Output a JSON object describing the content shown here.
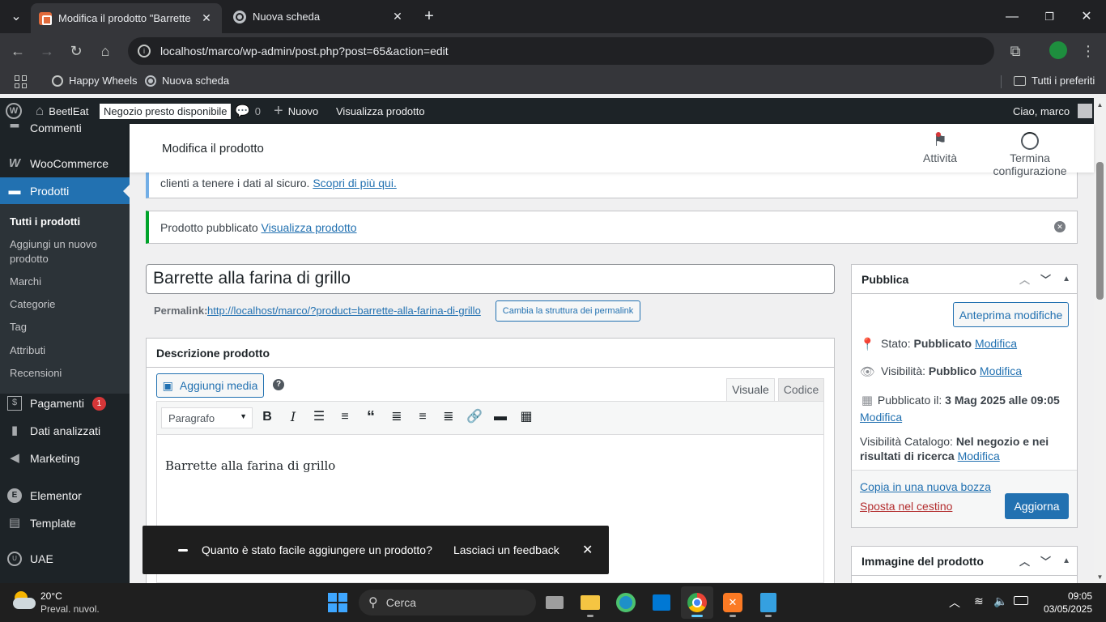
{
  "browser": {
    "tabs": [
      {
        "title": "Modifica il prodotto \"Barrette alla farina di grillo\"",
        "active": true
      },
      {
        "title": "Nuova scheda",
        "active": false
      }
    ],
    "address": "localhost/marco/wp-admin/post.php?post=65&action=edit",
    "bookmarks": [
      "Happy Wheels",
      "Nuova scheda"
    ],
    "all_bookmarks": "Tutti i preferiti"
  },
  "adminbar": {
    "site_name": "BeetlEat",
    "store_badge": "Negozio presto disponibile",
    "comments_count": "0",
    "new_label": "Nuovo",
    "view_product": "Visualizza prodotto",
    "greeting": "Ciao, marco"
  },
  "sidebar": {
    "items": [
      {
        "label": "Commenti",
        "icon": "comment-icon"
      },
      {
        "label": "WooCommerce",
        "icon": "woo-icon"
      },
      {
        "label": "Prodotti",
        "icon": "archive-icon"
      },
      {
        "label": "Pagamenti",
        "icon": "dollar-icon",
        "badge": "1"
      },
      {
        "label": "Dati analizzati",
        "icon": "bar-chart-icon"
      },
      {
        "label": "Marketing",
        "icon": "megaphone-icon"
      },
      {
        "label": "Elementor",
        "icon": "elementor-icon"
      },
      {
        "label": "Template",
        "icon": "folder-icon"
      },
      {
        "label": "UAE",
        "icon": "uae-icon"
      }
    ],
    "submenu": [
      "Tutti i prodotti",
      "Aggiungi un nuovo prodotto",
      "Marchi",
      "Categorie",
      "Tag",
      "Attributi",
      "Recensioni"
    ]
  },
  "header": {
    "title": "Modifica il prodotto",
    "activity": "Attività",
    "finish_setup": "Termina configurazione"
  },
  "notices": {
    "privacy_text": "clienti a tenere i dati al sicuro.",
    "privacy_link": "Scopri di più qui.",
    "published_text": "Prodotto pubblicato",
    "published_link": "Visualizza prodotto"
  },
  "product": {
    "title": "Barrette alla farina di grillo",
    "permalink_label": "Permalink:",
    "permalink_url": "http://localhost/marco/?product=barrette-alla-farina-di-grillo",
    "permalink_button": "Cambia la struttura dei permalink"
  },
  "description": {
    "heading": "Descrizione prodotto",
    "add_media": "Aggiungi media",
    "tab_visual": "Visuale",
    "tab_code": "Codice",
    "format_select": "Paragrafo",
    "content": "Barrette alla farina di grillo"
  },
  "publish": {
    "heading": "Pubblica",
    "preview_button": "Anteprima modifiche",
    "status_label": "Stato:",
    "status_value": "Pubblicato",
    "visibility_label": "Visibilità:",
    "visibility_value": "Pubblico",
    "published_label": "Pubblicato il:",
    "published_value": "3 Mag 2025 alle 09:05",
    "catalog_label": "Visibilità Catalogo:",
    "catalog_value": "Nel negozio e nei risultati di ricerca",
    "edit_link": "Modifica",
    "copy_draft": "Copia in una nuova bozza",
    "trash": "Sposta nel cestino",
    "update_button": "Aggiorna"
  },
  "product_image": {
    "heading": "Immagine del prodotto"
  },
  "toast": {
    "question": "Quanto è stato facile aggiungere un prodotto?",
    "action": "Lasciaci un feedback"
  },
  "taskbar": {
    "temperature": "20°C",
    "weather": "Preval. nuvol.",
    "search": "Cerca",
    "time": "09:05",
    "date": "03/05/2025"
  },
  "colors": {
    "wp_blue": "#2271b1",
    "admin_dark": "#1d2327",
    "success_green": "#00a32a",
    "danger_red": "#b32d2e"
  }
}
